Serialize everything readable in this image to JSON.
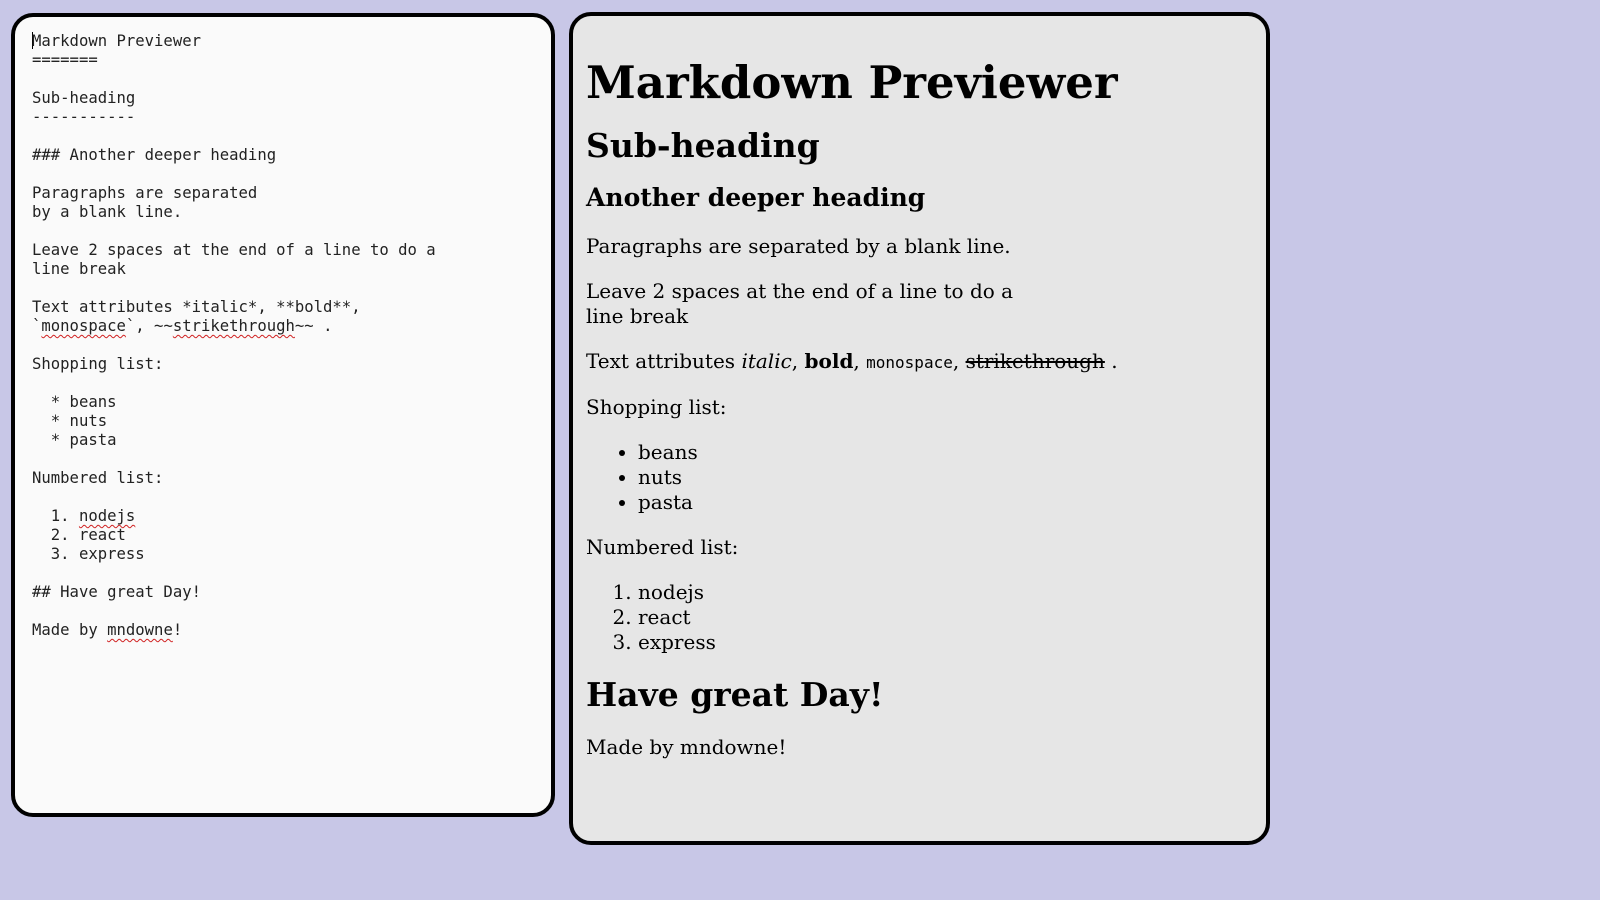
{
  "editor": {
    "lines": [
      {
        "segments": [
          {
            "text": "Markdown Previewer"
          }
        ]
      },
      {
        "segments": [
          {
            "text": "======="
          }
        ]
      },
      {
        "segments": [
          {
            "text": ""
          }
        ]
      },
      {
        "segments": [
          {
            "text": "Sub-heading"
          }
        ]
      },
      {
        "segments": [
          {
            "text": "-----------"
          }
        ]
      },
      {
        "segments": [
          {
            "text": ""
          }
        ]
      },
      {
        "segments": [
          {
            "text": "### Another deeper heading"
          }
        ]
      },
      {
        "segments": [
          {
            "text": ""
          }
        ]
      },
      {
        "segments": [
          {
            "text": "Paragraphs are separated"
          }
        ]
      },
      {
        "segments": [
          {
            "text": "by a blank line."
          }
        ]
      },
      {
        "segments": [
          {
            "text": ""
          }
        ]
      },
      {
        "segments": [
          {
            "text": "Leave 2 spaces at the end of a line to do a"
          }
        ]
      },
      {
        "segments": [
          {
            "text": "line break"
          }
        ]
      },
      {
        "segments": [
          {
            "text": ""
          }
        ]
      },
      {
        "segments": [
          {
            "text": "Text attributes *italic*, **bold**,"
          }
        ]
      },
      {
        "segments": [
          {
            "text": "`"
          },
          {
            "text": "monospace",
            "misspelled": true
          },
          {
            "text": "`, ~~"
          },
          {
            "text": "strikethrough",
            "misspelled": true
          },
          {
            "text": "~~ ."
          }
        ]
      },
      {
        "segments": [
          {
            "text": ""
          }
        ]
      },
      {
        "segments": [
          {
            "text": "Shopping list:"
          }
        ]
      },
      {
        "segments": [
          {
            "text": ""
          }
        ]
      },
      {
        "segments": [
          {
            "text": "  * beans"
          }
        ]
      },
      {
        "segments": [
          {
            "text": "  * nuts"
          }
        ]
      },
      {
        "segments": [
          {
            "text": "  * pasta"
          }
        ]
      },
      {
        "segments": [
          {
            "text": ""
          }
        ]
      },
      {
        "segments": [
          {
            "text": "Numbered list:"
          }
        ]
      },
      {
        "segments": [
          {
            "text": ""
          }
        ]
      },
      {
        "segments": [
          {
            "text": "  1. "
          },
          {
            "text": "nodejs",
            "misspelled": true
          }
        ]
      },
      {
        "segments": [
          {
            "text": "  2. react"
          }
        ]
      },
      {
        "segments": [
          {
            "text": "  3. express"
          }
        ]
      },
      {
        "segments": [
          {
            "text": ""
          }
        ]
      },
      {
        "segments": [
          {
            "text": "## Have great Day!"
          }
        ]
      },
      {
        "segments": [
          {
            "text": ""
          }
        ]
      },
      {
        "segments": [
          {
            "text": "Made by "
          },
          {
            "text": "mndowne",
            "misspelled": true
          },
          {
            "text": "!"
          }
        ]
      }
    ]
  },
  "preview": {
    "h1": "Markdown Previewer",
    "h2": "Sub-heading",
    "h3": "Another deeper heading",
    "paragraph1": "Paragraphs are separated by a blank line.",
    "linebreak": {
      "line1": "Leave 2 spaces at the end of a line to do a",
      "line2": "line break"
    },
    "attributes": {
      "prefix": "Text attributes ",
      "italic": "italic",
      "sep1": ", ",
      "bold": "bold",
      "sep2": ", ",
      "mono": "monospace",
      "sep3": ", ",
      "strike": "strikethrough",
      "suffix": " ."
    },
    "shopping_label": "Shopping list:",
    "shopping_items": [
      "beans",
      "nuts",
      "pasta"
    ],
    "numbered_label": "Numbered list:",
    "numbered_items": [
      "nodejs",
      "react",
      "express"
    ],
    "closing_heading": "Have great Day!",
    "made_by": "Made by mndowne!"
  },
  "colors": {
    "background": "#c8c7e7",
    "editor_bg": "#fafafa",
    "preview_bg": "#e6e6e6",
    "border": "#000000",
    "spellcheck": "#d02020"
  }
}
